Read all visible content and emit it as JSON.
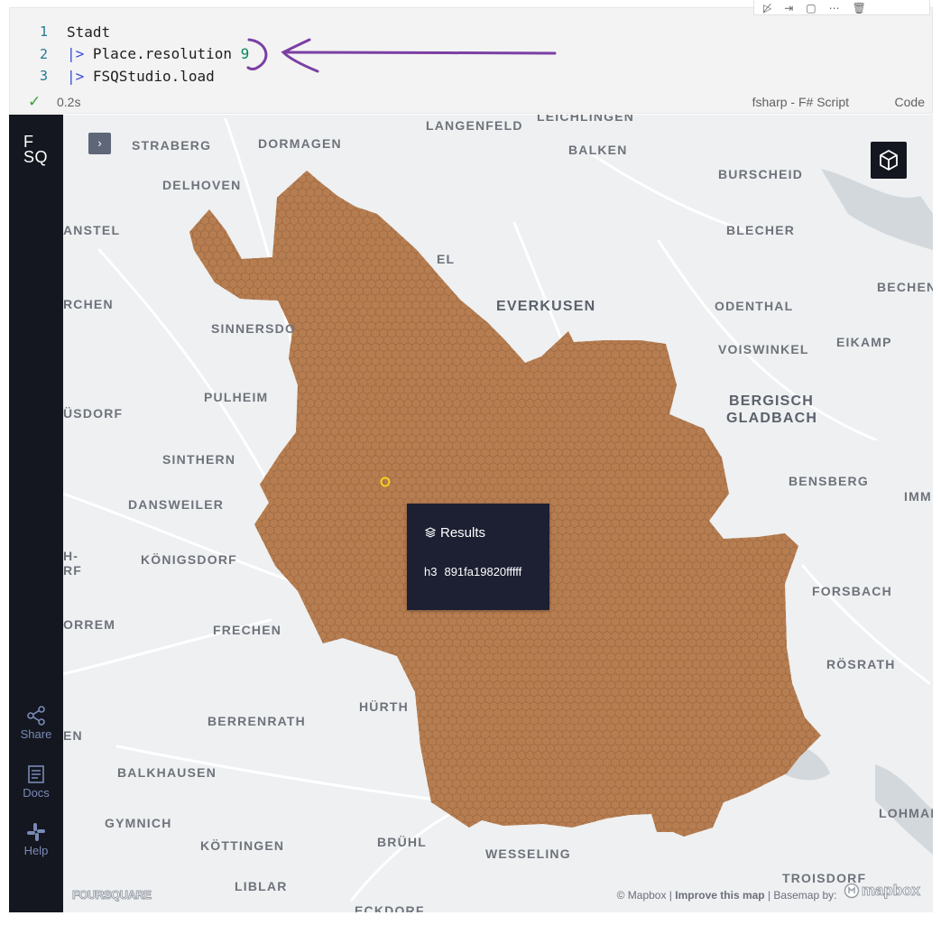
{
  "cell": {
    "code_lines": [
      {
        "number": "1",
        "parts": [
          {
            "text": "Stadt",
            "cls": "txt"
          }
        ]
      },
      {
        "number": "2",
        "parts": [
          {
            "text": "|>",
            "cls": "op"
          },
          {
            "text": " Place.resolution ",
            "cls": "txt"
          },
          {
            "text": "9",
            "cls": "num"
          }
        ]
      },
      {
        "number": "3",
        "parts": [
          {
            "text": "|>",
            "cls": "op"
          },
          {
            "text": " FSQStudio.load",
            "cls": "txt"
          }
        ]
      }
    ],
    "status": {
      "check": "✓",
      "time": "0.2s",
      "language": "fsharp - F# Script",
      "kind": "Code"
    },
    "annotation_color": "#7b3fa3"
  },
  "map": {
    "logo": "F\nSQ",
    "sidebar_buttons": [
      {
        "label": "Share",
        "icon": "share-icon"
      },
      {
        "label": "Docs",
        "icon": "book-icon"
      },
      {
        "label": "Help",
        "icon": "slack-icon"
      }
    ],
    "toggle": "›",
    "tooltip": {
      "title": "Results",
      "key": "h3",
      "value": "891fa19820fffff"
    },
    "attribution": {
      "mapbox": "© Mapbox",
      "improve": "Improve this map",
      "basemap": "Basemap by:",
      "mapbox_logo": "mapbox",
      "foursquare": "FOURSQUARE"
    },
    "hex_color": "#b67d50",
    "place_labels": [
      {
        "text": "LANGENFELD"
      },
      {
        "text": "LEICHLINGEN"
      },
      {
        "text": "STRABERG"
      },
      {
        "text": "DORMAGEN"
      },
      {
        "text": "BALKEN"
      },
      {
        "text": "BURSCHEID"
      },
      {
        "text": "DELHOVEN"
      },
      {
        "text": "ANSTEL"
      },
      {
        "text": "BLECHER"
      },
      {
        "text": "RCHEN"
      },
      {
        "text": "EVERKUSEN"
      },
      {
        "text": "ODENTHAL"
      },
      {
        "text": "BECHEN"
      },
      {
        "text": "SINNERSDO"
      },
      {
        "text": "VOISWINKEL"
      },
      {
        "text": "EIKAMP"
      },
      {
        "text": "PULHEIM"
      },
      {
        "text": "BERGISCH"
      },
      {
        "text": "GLADBACH"
      },
      {
        "text": "ÜSDORF"
      },
      {
        "text": "SINTHERN"
      },
      {
        "text": "BENSBERG"
      },
      {
        "text": "IMM"
      },
      {
        "text": "DANSWEILER"
      },
      {
        "text": "H-"
      },
      {
        "text": "RF"
      },
      {
        "text": "KÖNIGSDORF"
      },
      {
        "text": "FORSBACH"
      },
      {
        "text": "ORREM"
      },
      {
        "text": "FRECHEN"
      },
      {
        "text": "RÖSRATH"
      },
      {
        "text": "HÜRTH"
      },
      {
        "text": "BERRENRATH"
      },
      {
        "text": "EN"
      },
      {
        "text": "BALKHAUSEN"
      },
      {
        "text": "LOHMAR"
      },
      {
        "text": "GYMNICH"
      },
      {
        "text": "BRÜHL"
      },
      {
        "text": "KÖTTINGEN"
      },
      {
        "text": "WESSELING"
      },
      {
        "text": "TROISDORF"
      },
      {
        "text": "LIBLAR"
      },
      {
        "text": "ECKDORF"
      },
      {
        "text": "EL"
      }
    ]
  }
}
